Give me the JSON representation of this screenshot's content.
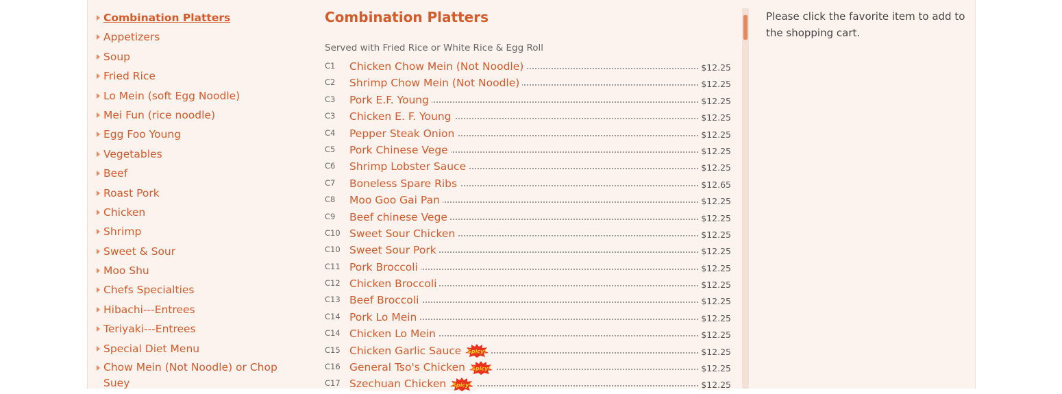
{
  "sidebar": {
    "categories": [
      "Combination Platters",
      "Appetizers",
      "Soup",
      "Fried Rice",
      "Lo Mein (soft Egg Noodle)",
      "Mei Fun (rice noodle)",
      "Egg Foo Young",
      "Vegetables",
      "Beef",
      "Roast Pork",
      "Chicken",
      "Shrimp",
      "Sweet & Sour",
      "Moo Shu",
      "Chefs Specialties",
      "Hibachi---Entrees",
      "Teriyaki---Entrees",
      "Special Diet Menu",
      "Chow Mein (Not Noodle) or Chop Suey"
    ]
  },
  "menu": {
    "title": "Combination Platters",
    "subtitle": "Served with Fried Rice or White Rice & Egg Roll",
    "items": [
      {
        "code": "C1",
        "name": "Chicken Chow Mein (Not Noodle)",
        "price": "$12.25",
        "spicy": false
      },
      {
        "code": "C2",
        "name": "Shrimp Chow Mein (Not Noodle)",
        "price": "$12.25",
        "spicy": false
      },
      {
        "code": "C3",
        "name": "Pork E.F. Young",
        "price": "$12.25",
        "spicy": false
      },
      {
        "code": "C3",
        "name": "Chicken E. F. Young",
        "price": "$12.25",
        "spicy": false
      },
      {
        "code": "C4",
        "name": "Pepper Steak Onion",
        "price": "$12.25",
        "spicy": false
      },
      {
        "code": "C5",
        "name": "Pork Chinese Vege",
        "price": "$12.25",
        "spicy": false
      },
      {
        "code": "C6",
        "name": "Shrimp Lobster Sauce",
        "price": "$12.25",
        "spicy": false
      },
      {
        "code": "C7",
        "name": "Boneless Spare Ribs",
        "price": "$12.65",
        "spicy": false
      },
      {
        "code": "C8",
        "name": "Moo Goo Gai Pan",
        "price": "$12.25",
        "spicy": false
      },
      {
        "code": "C9",
        "name": "Beef chinese Vege",
        "price": "$12.25",
        "spicy": false
      },
      {
        "code": "C10",
        "name": "Sweet Sour Chicken",
        "price": "$12.25",
        "spicy": false
      },
      {
        "code": "C10",
        "name": "Sweet Sour Pork",
        "price": "$12.25",
        "spicy": false
      },
      {
        "code": "C11",
        "name": "Pork Broccoli",
        "price": "$12.25",
        "spicy": false
      },
      {
        "code": "C12",
        "name": "Chicken Broccoli",
        "price": "$12.25",
        "spicy": false
      },
      {
        "code": "C13",
        "name": "Beef Broccoli",
        "price": "$12.25",
        "spicy": false
      },
      {
        "code": "C14",
        "name": "Pork Lo Mein",
        "price": "$12.25",
        "spicy": false
      },
      {
        "code": "C14",
        "name": "Chicken Lo Mein",
        "price": "$12.25",
        "spicy": false
      },
      {
        "code": "C15",
        "name": "Chicken Garlic Sauce",
        "price": "$12.25",
        "spicy": true
      },
      {
        "code": "C16",
        "name": "General Tso's Chicken",
        "price": "$12.25",
        "spicy": true
      },
      {
        "code": "C17",
        "name": "Szechuan Chicken",
        "price": "$12.25",
        "spicy": true
      }
    ],
    "spicy_badge_text": "Spicy!"
  },
  "cart": {
    "message": "Please click the favorite item to add to the shopping cart."
  },
  "colors": {
    "accent": "#d35a2a",
    "panel_bg": "#fdf3ee",
    "scroll_thumb": "#e9875c"
  }
}
